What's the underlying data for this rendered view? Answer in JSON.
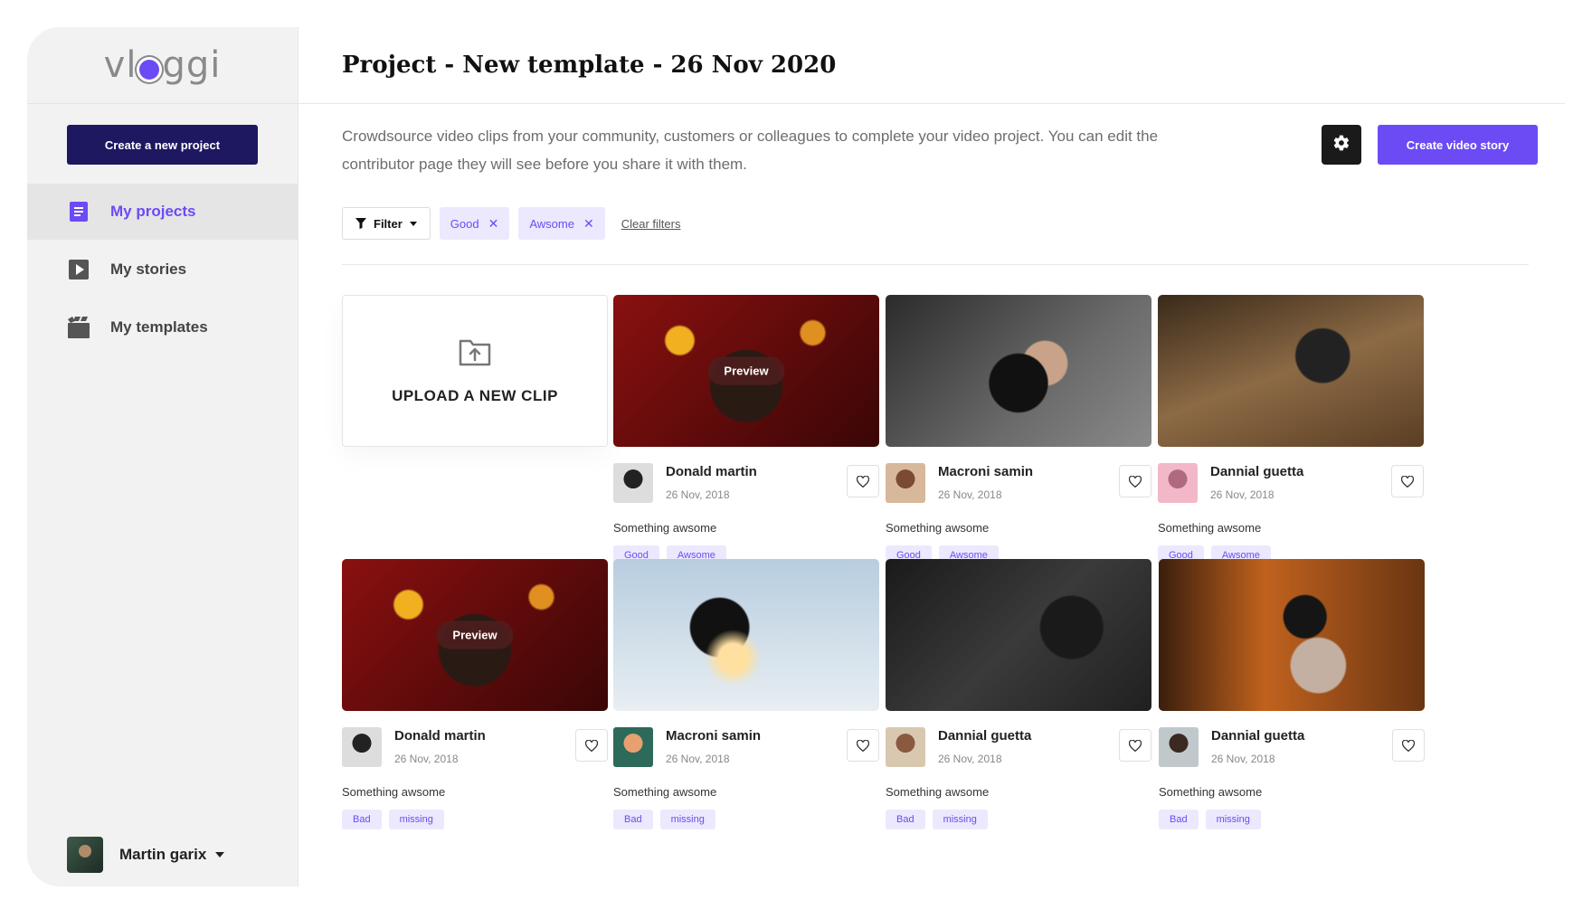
{
  "sidebar": {
    "logo": "vloggi",
    "new_project_label": "Create a new project",
    "nav": [
      {
        "label": "My projects",
        "icon": "document-icon",
        "active": true
      },
      {
        "label": "My stories",
        "icon": "play-icon",
        "active": false
      },
      {
        "label": "My templates",
        "icon": "clapperboard-icon",
        "active": false
      }
    ],
    "user": {
      "name": "Martin garix"
    }
  },
  "header": {
    "title": "Project - New template - 26 Nov 2020"
  },
  "intro": {
    "description": "Crowdsource video clips from your community, customers or colleagues to complete your video project. You can edit the contributor page they will see before you share it with them.",
    "create_story_label": "Create video story"
  },
  "filters": {
    "filter_label": "Filter",
    "chips": [
      "Good",
      "Awsome"
    ],
    "clear_label": "Clear filters"
  },
  "upload": {
    "label": "UPLOAD A NEW CLIP"
  },
  "preview_label": "Preview",
  "clips": [
    {
      "name": "Donald martin",
      "date": "26 Nov, 2018",
      "caption": "Something awsome",
      "tags": [
        "Good",
        "Awsome"
      ],
      "preview": true
    },
    {
      "name": "Macroni samin",
      "date": "26 Nov, 2018",
      "caption": "Something awsome",
      "tags": [
        "Good",
        "Awsome"
      ],
      "preview": false
    },
    {
      "name": "Dannial guetta",
      "date": "26 Nov, 2018",
      "caption": "Something awsome",
      "tags": [
        "Good",
        "Awsome"
      ],
      "preview": false
    },
    {
      "name": "Donald martin",
      "date": "26 Nov, 2018",
      "caption": "Something awsome",
      "tags": [
        "Bad",
        "missing"
      ],
      "preview": true
    },
    {
      "name": "Macroni samin",
      "date": "26 Nov, 2018",
      "caption": "Something awsome",
      "tags": [
        "Bad",
        "missing"
      ],
      "preview": false
    },
    {
      "name": "Dannial guetta",
      "date": "26 Nov, 2018",
      "caption": "Something awsome",
      "tags": [
        "Bad",
        "missing"
      ],
      "preview": false
    },
    {
      "name": "Dannial guetta",
      "date": "26 Nov, 2018",
      "caption": "Something awsome",
      "tags": [
        "Bad",
        "missing"
      ],
      "preview": false
    }
  ],
  "colors": {
    "accent": "#6c4bf5",
    "navy": "#1d1860",
    "tag_bg": "#ece8fd"
  }
}
